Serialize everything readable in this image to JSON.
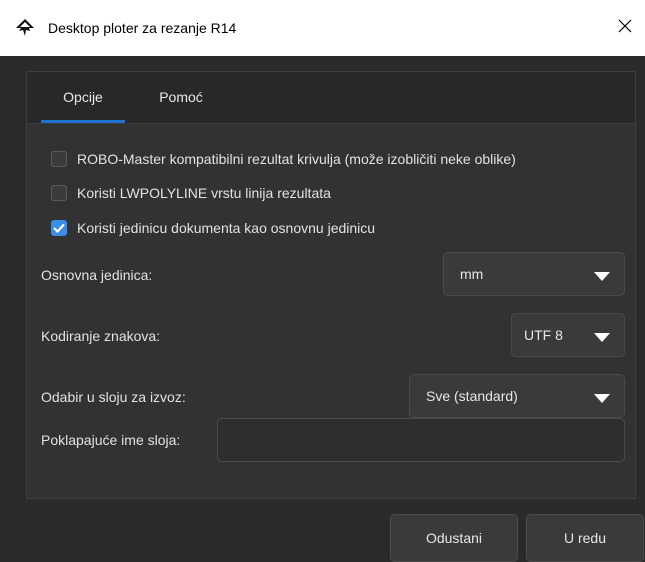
{
  "window": {
    "title": "Desktop ploter za rezanje R14",
    "app_icon": "inkscape-logo-icon",
    "close_icon": "close-icon"
  },
  "tabs": [
    {
      "label": "Opcije",
      "active": true
    },
    {
      "label": "Pomoć",
      "active": false
    }
  ],
  "options": {
    "robo_master": {
      "label": "ROBO-Master kompatibilni rezultat krivulja (može izobličiti neke oblike)",
      "checked": false
    },
    "lwpolyline": {
      "label": "Koristi LWPOLYLINE vrstu linija rezultata",
      "checked": false
    },
    "document_unit": {
      "label": "Koristi jedinicu dokumenta kao osnovnu jedinicu",
      "checked": true
    }
  },
  "fields": {
    "base_unit": {
      "label": "Osnovna jedinica:",
      "value": "mm"
    },
    "encoding": {
      "label": "Kodiranje znakova:",
      "value": "UTF 8"
    },
    "layer_selection": {
      "label": "Odabir u sloju za izvoz:",
      "value": "Sve (standard)"
    },
    "layer_name": {
      "label": "Poklapajuće ime sloja:",
      "value": ""
    }
  },
  "buttons": {
    "cancel": "Odustani",
    "ok": "U redu"
  },
  "colors": {
    "accent": "#1e73d2",
    "check": "#3b8ee6",
    "background": "#2b2b2b"
  }
}
